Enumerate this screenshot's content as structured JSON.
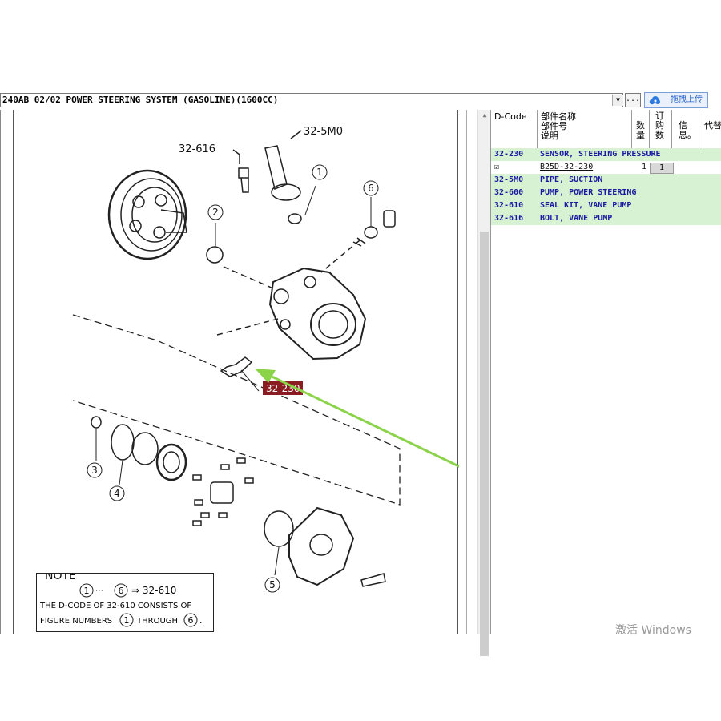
{
  "window": {
    "path_title": "240AB 02/02 POWER STEERING SYSTEM (GASOLINE)(1600CC)",
    "dots_button": "...",
    "upload_button": "拖拽上传"
  },
  "grid": {
    "headers": {
      "dcode": "D-Code",
      "name_l1": "部件名称",
      "name_l2": "部件号",
      "name_l3": "说明",
      "qty": "数量",
      "order_qty": "订购数",
      "info": "信息。",
      "replace": "代替"
    },
    "rows": [
      {
        "code": "32-230",
        "name": "SENSOR, STEERING PRESSURE"
      },
      {
        "code": "32-5M0",
        "name": "PIPE, SUCTION"
      },
      {
        "code": "32-600",
        "name": "PUMP, POWER STEERING"
      },
      {
        "code": "32-610",
        "name": "SEAL KIT, VANE PUMP"
      },
      {
        "code": "32-616",
        "name": "BOLT, VANE PUMP"
      }
    ],
    "detail": {
      "check": "☑",
      "part_number": "B25D-32-230",
      "qty": "1",
      "order_qty": "1"
    }
  },
  "diagram": {
    "callouts": {
      "c616": "32-616",
      "c5m0": "32-5M0",
      "c230": "32-230",
      "n1": "1",
      "n2": "2",
      "n3": "3",
      "n4": "4",
      "n5": "5",
      "n6": "6"
    },
    "note": {
      "title": "NOTE",
      "line1_a": "1",
      "line1_b": "6",
      "line1_c": "⇒ 32-610",
      "line2": "THE D-CODE OF  32-610  CONSISTS OF",
      "line3_a": "FIGURE NUMBERS",
      "line3_b": "1",
      "line3_c": "THROUGH",
      "line3_d": "6",
      "line3_e": "."
    }
  },
  "os": {
    "watermark": "激活 Windows"
  },
  "colors": {
    "highlight_row": "#d6f2d2",
    "code_text": "#1a1aa0",
    "selected_callout": "#8b1c22",
    "arrow": "#8bd44a"
  }
}
